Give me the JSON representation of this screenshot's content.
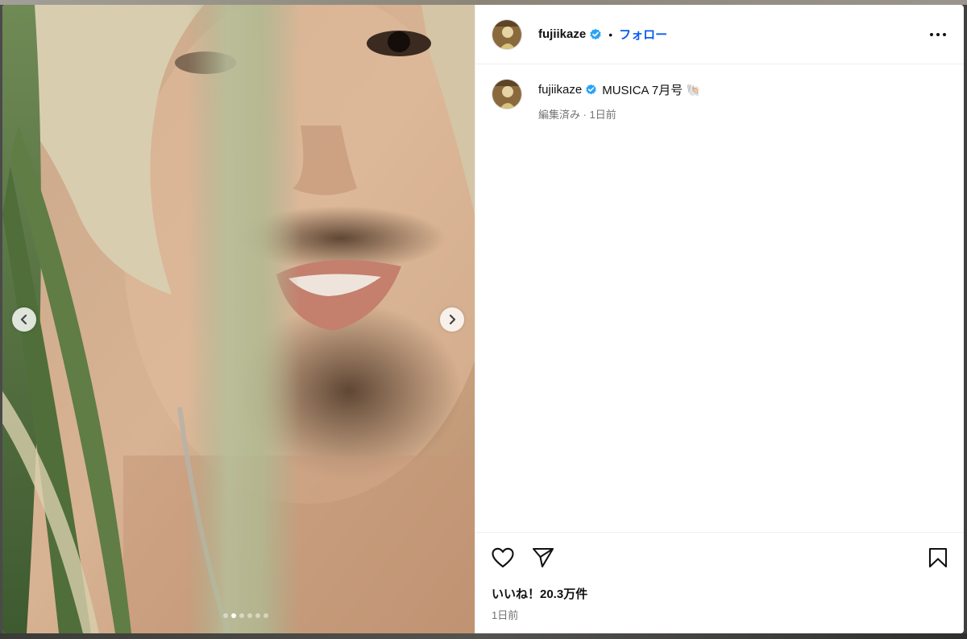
{
  "post": {
    "username": "fujiikaze",
    "follow_label": "フォロー",
    "separator": "•",
    "caption": {
      "username": "fujiikaze",
      "text": "MUSICA 7月号 🐚",
      "meta": "編集済み · 1日前"
    },
    "likes_text": "いいね！20.3万件",
    "date_text": "1日前"
  },
  "carousel": {
    "total_slides": 6,
    "active_index": 1
  },
  "icons": {
    "verified": "verified-badge-icon",
    "more": "more-options-icon",
    "like": "heart-icon",
    "share": "paper-plane-icon",
    "save": "bookmark-icon",
    "prev": "chevron-left-icon",
    "next": "chevron-right-icon"
  },
  "colors": {
    "accent": "#0b5cf0",
    "verified": "#2aa3f5",
    "muted_text": "#737373"
  }
}
